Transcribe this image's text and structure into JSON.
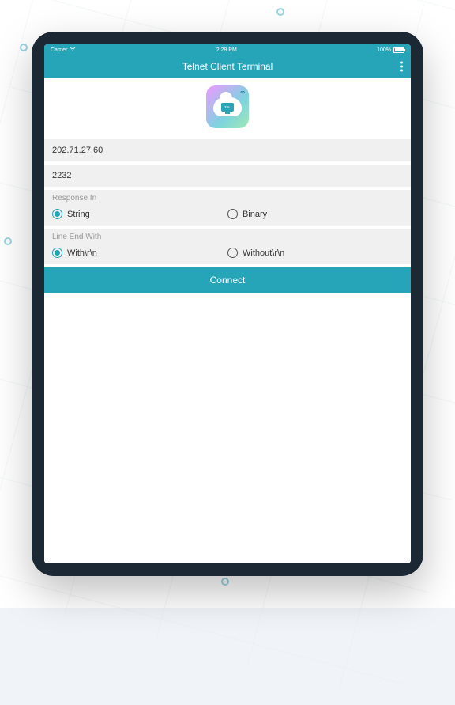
{
  "statusbar": {
    "carrier": "Carrier",
    "time": "2:28 PM",
    "battery_pct": "100%"
  },
  "header": {
    "title": "Telnet Client Terminal"
  },
  "logo": {
    "monitor_text": "TEL",
    "infinity": "∞"
  },
  "form": {
    "host_value": "202.71.27.60",
    "port_value": "2232",
    "response_label": "Response In",
    "response_options": [
      {
        "label": "String",
        "selected": true
      },
      {
        "label": "Binary",
        "selected": false
      }
    ],
    "lineend_label": "Line End With",
    "lineend_options": [
      {
        "label": "With\\r\\n",
        "selected": true
      },
      {
        "label": "Without\\r\\n",
        "selected": false
      }
    ],
    "connect_label": "Connect"
  },
  "colors": {
    "accent": "#26a5b8",
    "field_bg": "#f0f0f0"
  }
}
